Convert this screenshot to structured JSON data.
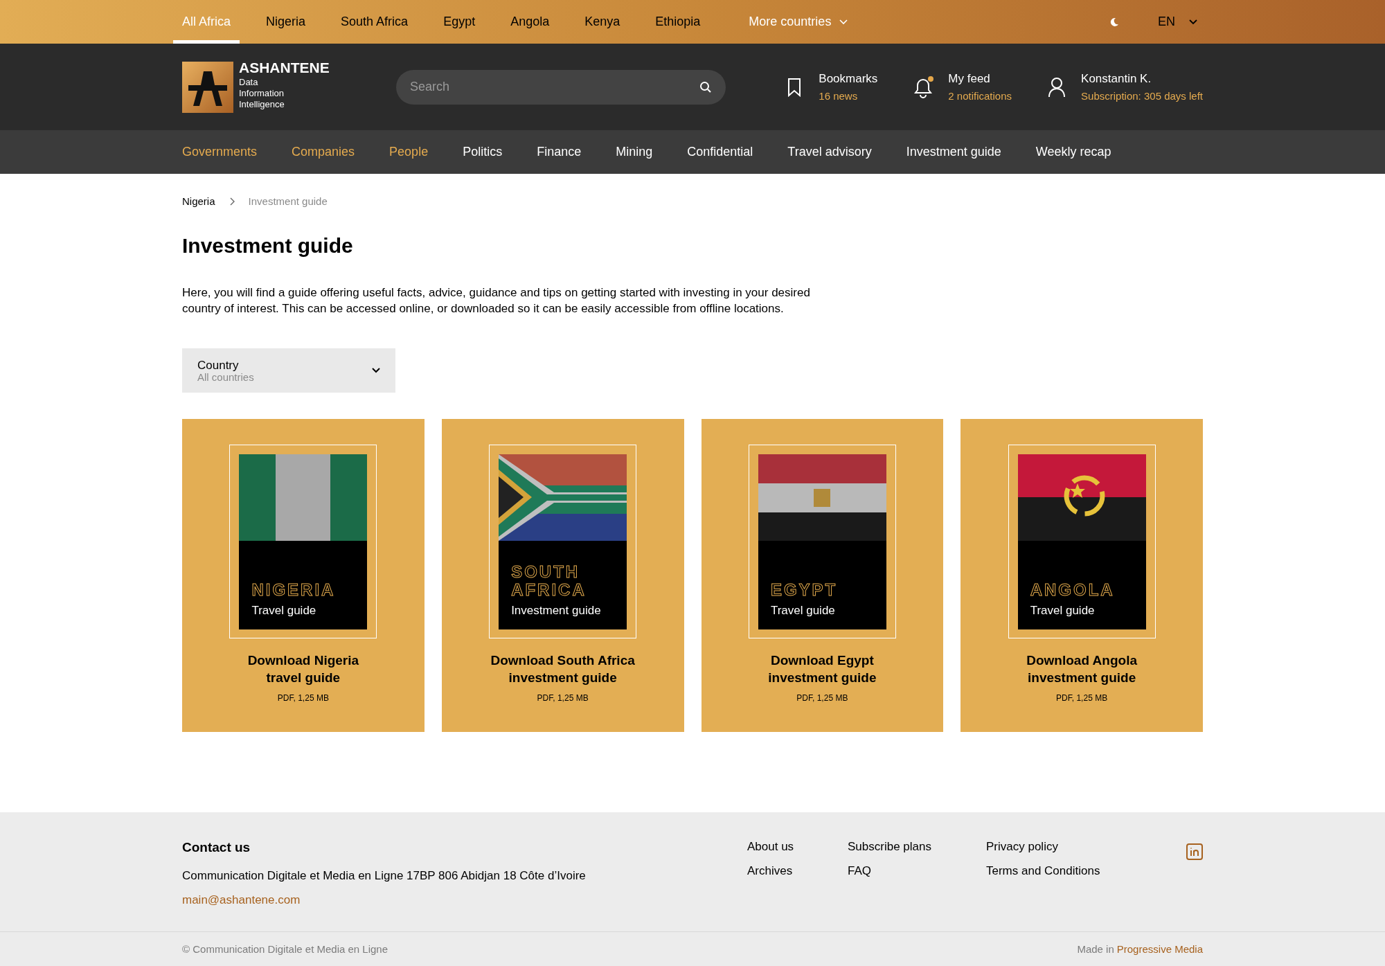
{
  "country_tabs": [
    {
      "label": "All Africa",
      "selected": true
    },
    {
      "label": "Nigeria",
      "selected": false
    },
    {
      "label": "South Africa",
      "selected": false
    },
    {
      "label": "Egypt",
      "selected": false
    },
    {
      "label": "Angola",
      "selected": false
    },
    {
      "label": "Kenya",
      "selected": false
    },
    {
      "label": "Ethiopia",
      "selected": false
    }
  ],
  "more_countries": {
    "label": "More countries"
  },
  "language": {
    "label": "EN"
  },
  "header": {
    "logo": {
      "name": "ASHANTENE",
      "tagline": [
        "Data",
        "Information",
        "Intelligence"
      ]
    },
    "search": {
      "placeholder": "Search"
    },
    "bookmarks": {
      "title": "Bookmarks",
      "subtitle": "16 news"
    },
    "feed": {
      "title": "My feed",
      "subtitle": "2 notifications",
      "unread": true
    },
    "account": {
      "title": "Konstantin K.",
      "subtitle": "Subscription: 305 days left"
    }
  },
  "sections": [
    {
      "label": "Governments",
      "highlighted": true
    },
    {
      "label": "Companies",
      "highlighted": true
    },
    {
      "label": "People",
      "highlighted": true
    },
    {
      "label": "Politics",
      "highlighted": false
    },
    {
      "label": "Finance",
      "highlighted": false
    },
    {
      "label": "Mining",
      "highlighted": false
    },
    {
      "label": "Confidential",
      "highlighted": false
    },
    {
      "label": "Travel advisory",
      "highlighted": false
    },
    {
      "label": "Investment guide",
      "highlighted": false
    },
    {
      "label": "Weekly recap",
      "highlighted": false
    }
  ],
  "breadcrumb": [
    "Nigeria",
    "Investment guide"
  ],
  "title": "Investment guide",
  "intro": "Here, you will find a guide offering useful facts, advice, guidance and tips on getting started with investing in your desired country of interest. This can be accessed online, or downloaded so it can be easily accessible from offline locations.",
  "filter": {
    "label": "Country",
    "value": "All countries"
  },
  "guides": [
    {
      "kind": "nigeria",
      "cover_title": "NIGERIA",
      "cover_subtitle": "Travel guide",
      "download_title": "Download Nigeria travel guide",
      "file_info": "PDF, 1,25 MB"
    },
    {
      "kind": "south_africa",
      "cover_title": "SOUTH AFRICA",
      "cover_subtitle": "Investment guide",
      "download_title": "Download South Africa investment guide",
      "file_info": "PDF, 1,25 MB"
    },
    {
      "kind": "egypt",
      "cover_title": "EGYPT",
      "cover_subtitle": "Travel guide",
      "download_title": "Download Egypt investment guide",
      "file_info": "PDF, 1,25 MB"
    },
    {
      "kind": "angola",
      "cover_title": "ANGOLA",
      "cover_subtitle": "Travel guide",
      "download_title": "Download Angola investment guide",
      "file_info": "PDF, 1,25 MB"
    }
  ],
  "footer": {
    "heading": "Contact us",
    "address": "Communication Digitale et Media en Ligne 17BP 806 Abidjan 18 Côte d’Ivoire",
    "email": "main@ashantene.com",
    "link_columns": [
      [
        "About us",
        "Archives"
      ],
      [
        "Subscribe plans",
        "FAQ"
      ],
      [
        "Privacy policy",
        "Terms and Conditions"
      ]
    ],
    "copyright": "© Communication Digitale et Media en Ligne",
    "made_in": {
      "prefix": "Made in",
      "link": "Progressive Media"
    }
  }
}
